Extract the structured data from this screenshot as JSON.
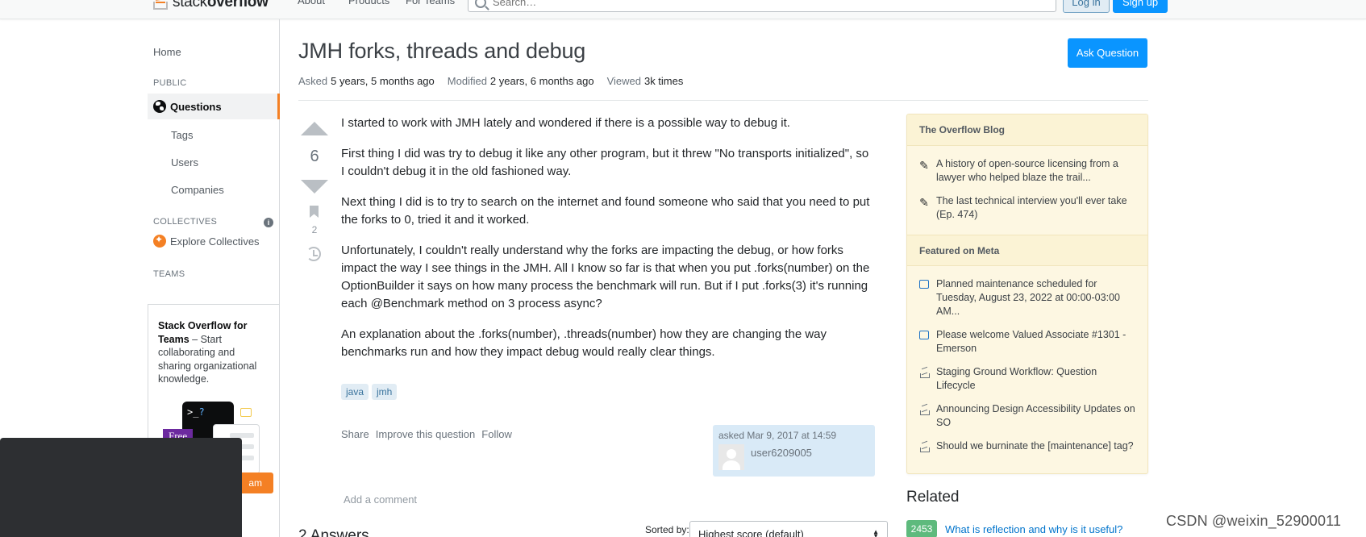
{
  "header": {
    "logo_stack": "stack",
    "logo_overflow": "overflow",
    "nav": [
      "About",
      "Products",
      "For Teams"
    ],
    "search_placeholder": "Search…",
    "login": "Log in",
    "signup": "Sign up"
  },
  "sidebar": {
    "home": "Home",
    "public": "PUBLIC",
    "questions": "Questions",
    "tags": "Tags",
    "users": "Users",
    "companies": "Companies",
    "collectives": "COLLECTIVES",
    "explore_collectives": "Explore Collectives",
    "teams": "TEAMS",
    "teams_title": "Stack Overflow for Teams",
    "teams_desc": " – Start collaborating and sharing organizational knowledge.",
    "terminal_prompt": ">_",
    "terminal_q": "?",
    "free_badge": "Free",
    "cta": "am"
  },
  "question": {
    "title": "JMH forks, threads and debug",
    "ask_button": "Ask Question",
    "asked_label": "Asked",
    "asked_value": "5 years, 5 months ago",
    "modified_label": "Modified",
    "modified_value": "2 years, 6 months ago",
    "viewed_label": "Viewed",
    "viewed_value": "3k times",
    "votes": "6",
    "bookmarks": "2",
    "body": [
      "I started to work with JMH lately and wondered if there is a possible way to debug it.",
      "First thing I did was try to debug it like any other program, but it threw \"No transports initialized\", so I couldn't debug it in the old fashioned way.",
      "Next thing I did is to try to search on the internet and found someone who said that you need to put the forks to 0, tried it and it worked.",
      "Unfortunately, I couldn't really understand why the forks are impacting the debug, or how forks impact the way I see things in the JMH. All I know so far is that when you put .forks(number) on the OptionBuilder it says on how many process the benchmark will run. But if I put .forks(3) it's running each @Benchmark method on 3 process async?",
      "An explanation about the .forks(number), .threads(number) how they are changing the way benchmarks run and how they impact debug would really clear things."
    ],
    "tags": [
      "java",
      "jmh"
    ],
    "menu": [
      "Share",
      "Improve this question",
      "Follow"
    ],
    "asked_card": "asked Mar 9, 2017 at 14:59",
    "user": "user6209005",
    "add_comment": "Add a comment"
  },
  "answers": {
    "count": "2 Answers",
    "sort_label": "Sorted by:",
    "sort_value": "Highest score (default)"
  },
  "blog": {
    "header": "The Overflow Blog",
    "items": [
      "A history of open-source licensing from a lawyer who helped blaze the trail...",
      "The last technical interview you'll ever take (Ep. 474)"
    ],
    "meta_header": "Featured on Meta",
    "meta_items": [
      "Planned maintenance scheduled for Tuesday, August 23, 2022 at 00:00-03:00 AM...",
      "Please welcome Valued Associate #1301 - Emerson",
      "Staging Ground Workflow: Question Lifecycle",
      "Announcing Design Accessibility Updates on SO",
      "Should we burninate the [maintenance] tag?"
    ]
  },
  "related": {
    "title": "Related",
    "items": [
      {
        "score": "2453",
        "text": "What is reflection and why is it useful?"
      }
    ]
  },
  "watermark": "CSDN @weixin_52900011",
  "colors": {
    "accent": "#0a95ff",
    "brand": "#f48024",
    "blog_bg": "#fdf7e2",
    "score_green": "#5eba7d"
  }
}
